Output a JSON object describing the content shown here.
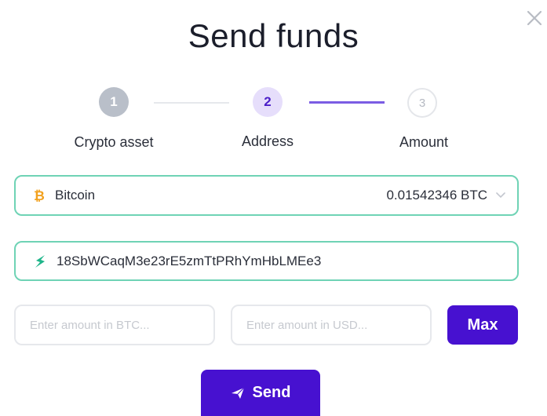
{
  "modal": {
    "title": "Send funds",
    "close_icon": "close-icon"
  },
  "stepper": {
    "steps": [
      {
        "number": "1",
        "label": "Crypto asset",
        "state": "completed"
      },
      {
        "number": "2",
        "label": "Address",
        "state": "active"
      },
      {
        "number": "3",
        "label": "Amount",
        "state": "upcoming"
      }
    ]
  },
  "asset_select": {
    "icon": "bitcoin-icon",
    "asset": "Bitcoin",
    "balance": "0.01542346 BTC",
    "dropdown_icon": "chevron-down-icon"
  },
  "address": {
    "icon": "wallet-address-icon",
    "value": "18SbWCaqM3e23rE5zmTtPRhYmHbLMEe3"
  },
  "amount": {
    "btc_placeholder": "Enter amount in BTC...",
    "usd_placeholder": "Enter amount in USD...",
    "max_label": "Max"
  },
  "send": {
    "icon": "paper-plane-icon",
    "label": "Send"
  },
  "colors": {
    "accent": "#4711d0",
    "field_border": "#6fd3b5",
    "bitcoin": "#f2a01c",
    "address_icon": "#1fb58a"
  }
}
